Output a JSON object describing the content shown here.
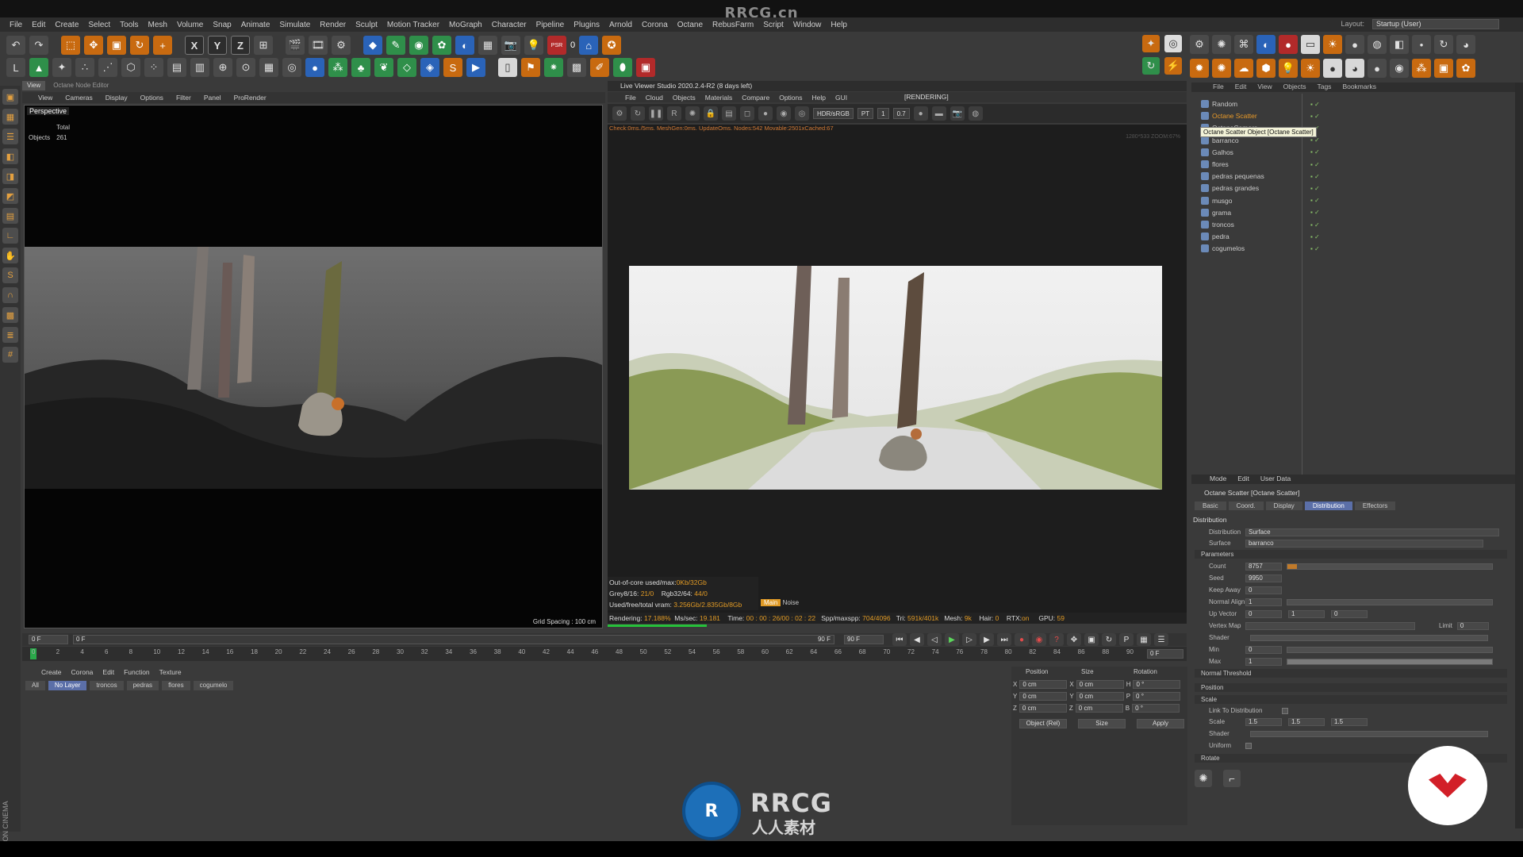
{
  "watermark": "RRCG.cn",
  "menu": [
    "File",
    "Edit",
    "Create",
    "Select",
    "Tools",
    "Mesh",
    "Volume",
    "Snap",
    "Animate",
    "Simulate",
    "Render",
    "Sculpt",
    "Motion Tracker",
    "MoGraph",
    "Character",
    "Pipeline",
    "Plugins",
    "Arnold",
    "Corona",
    "Octane",
    "RebusFarm",
    "Script",
    "Window",
    "Help"
  ],
  "layout": {
    "label": "Layout:",
    "value": "Startup (User)"
  },
  "toolbar": {
    "psr_label": "PSR",
    "psr_value": "0",
    "axis_x": "X",
    "axis_y": "Y",
    "axis_z": "Z"
  },
  "viewport": {
    "tabs": [
      "View",
      "Octane Node Editor"
    ],
    "menu": [
      "View",
      "Cameras",
      "Display",
      "Options",
      "Filter",
      "Panel",
      "ProRender"
    ],
    "label": "Perspective",
    "stats_header": "Total",
    "stats_label": "Objects",
    "stats_value": "261",
    "grid_spacing": "Grid Spacing : 100 cm"
  },
  "live_viewer": {
    "title": "Live Viewer Studio 2020.2.4-R2 (8 days left)",
    "menu": [
      "File",
      "Cloud",
      "Objects",
      "Materials",
      "Compare",
      "Options",
      "Help",
      "GUI"
    ],
    "status": "[RENDERING]",
    "check_line": "Check:0ms./5ms. MeshGen:0ms. UpdateOms. Nodes:542 Movable:2501xCached:67",
    "zoom": "1280*533 ZOOM:67%",
    "color_space": "HDR/sRGB",
    "kernel": "PT",
    "val1": "1",
    "val2": "0.7",
    "info": [
      {
        "label": "Out-of-core used/max:",
        "value": "0Kb/32Gb"
      },
      {
        "label": "Grey8/16: ",
        "value": "21/0",
        "label2": "Rgb32/64: ",
        "value2": "44/0"
      },
      {
        "label": "Used/free/total vram: ",
        "value": "3.256Gb/2.835Gb/8Gb"
      }
    ],
    "noise_pill": "Main",
    "noise_label": "Noise",
    "render_line": {
      "rendering_label": "Rendering: ",
      "rendering": "17.188%",
      "ms_label": "Ms/sec: ",
      "ms": "19.181",
      "time_label": "Time: ",
      "time": "00 : 00 : 26/00 : 02 : 22",
      "spp_label": "Spp/maxspp: ",
      "spp": "704/4096",
      "tri_label": "Tri: ",
      "tri": "591k/401k",
      "mesh_label": "Mesh: ",
      "mesh": "9k",
      "hair_label": "Hair: ",
      "hair": "0",
      "rtx_label": "RTX:",
      "rtx": "on",
      "gpu_label": "GPU:",
      "gpu": "59"
    },
    "progress": 0.17188
  },
  "timeline": {
    "start": "0 F",
    "start2": "0 F",
    "end": "90 F",
    "end2": "90 F",
    "current": "0 F",
    "ticks": [
      "0",
      "2",
      "4",
      "6",
      "8",
      "10",
      "12",
      "14",
      "16",
      "18",
      "20",
      "22",
      "24",
      "26",
      "28",
      "30",
      "32",
      "34",
      "36",
      "38",
      "40",
      "42",
      "44",
      "46",
      "48",
      "50",
      "52",
      "54",
      "56",
      "58",
      "60",
      "62",
      "64",
      "66",
      "68",
      "70",
      "72",
      "74",
      "76",
      "78",
      "80",
      "82",
      "84",
      "86",
      "88",
      "90"
    ]
  },
  "manager": {
    "menu": [
      "Create",
      "Corona",
      "Edit",
      "Function",
      "Texture"
    ],
    "layer_tabs": [
      "All",
      "No Layer",
      "troncos",
      "pedras",
      "flores",
      "cogumelo"
    ]
  },
  "coords": {
    "headers": [
      "Position",
      "Size",
      "Rotation"
    ],
    "rows": [
      {
        "axis": "X",
        "pos": "0 cm",
        "saxis": "X",
        "size": "0 cm",
        "raxis": "H",
        "rot": "0 °"
      },
      {
        "axis": "Y",
        "pos": "0 cm",
        "saxis": "Y",
        "size": "0 cm",
        "raxis": "P",
        "rot": "0 °"
      },
      {
        "axis": "Z",
        "pos": "0 cm",
        "saxis": "Z",
        "size": "0 cm",
        "raxis": "B",
        "rot": "0 °"
      }
    ],
    "mode": "Object (Rel)",
    "size_mode": "Size",
    "apply": "Apply"
  },
  "object_manager": {
    "menu": [
      "File",
      "Edit",
      "View",
      "Objects",
      "Tags",
      "Bookmarks"
    ],
    "tooltip": "Octane Scatter Object [Octane Scatter]",
    "objects": [
      "Random",
      "Octane Scatter",
      "OctaneCamera",
      "barranco",
      "Galhos",
      "flores",
      "pedras pequenas",
      "pedras grandes",
      "musgo",
      "grama",
      "troncos",
      "pedra",
      "cogumelos"
    ],
    "selected_index": 1
  },
  "attributes": {
    "menu": [
      "Mode",
      "Edit",
      "User Data"
    ],
    "object": "Octane Scatter [Octane Scatter]",
    "tabs": [
      "Basic",
      "Coord.",
      "Display",
      "Distribution",
      "Effectors"
    ],
    "active_tab": "Distribution",
    "section": "Distribution",
    "distribution_label": "Distribution",
    "distribution_value": "Surface",
    "surface_label": "Surface",
    "surface_value": "barranco",
    "parameters": "Parameters",
    "count_label": "Count",
    "count": "8757",
    "seed_label": "Seed",
    "seed": "9950",
    "keep_label": "Keep Away",
    "keep": "0",
    "normal_align_label": "Normal Align",
    "normal_align": "1",
    "up_label": "Up Vector",
    "up": [
      "0",
      "1",
      "0"
    ],
    "vertex_label": "Vertex Map",
    "limit_label": "Limit",
    "limit": "0",
    "shader_label": "Shader",
    "min_label": "Min",
    "min": "0",
    "max_label": "Max",
    "max": "1",
    "normal_threshold": "Normal Threshold",
    "position": "Position",
    "scale": "Scale",
    "link_label": "Link To Distribution",
    "scale_label": "Scale",
    "scale_values": [
      "1.5",
      "1.5",
      "1.5"
    ],
    "shader2_label": "Shader",
    "uniform_label": "Uniform",
    "rotate": "Rotate"
  },
  "logo": {
    "text": "RRCG",
    "sub": "人人素材",
    "mark": "R"
  },
  "maxon": "MAXON CINEMA 4D"
}
